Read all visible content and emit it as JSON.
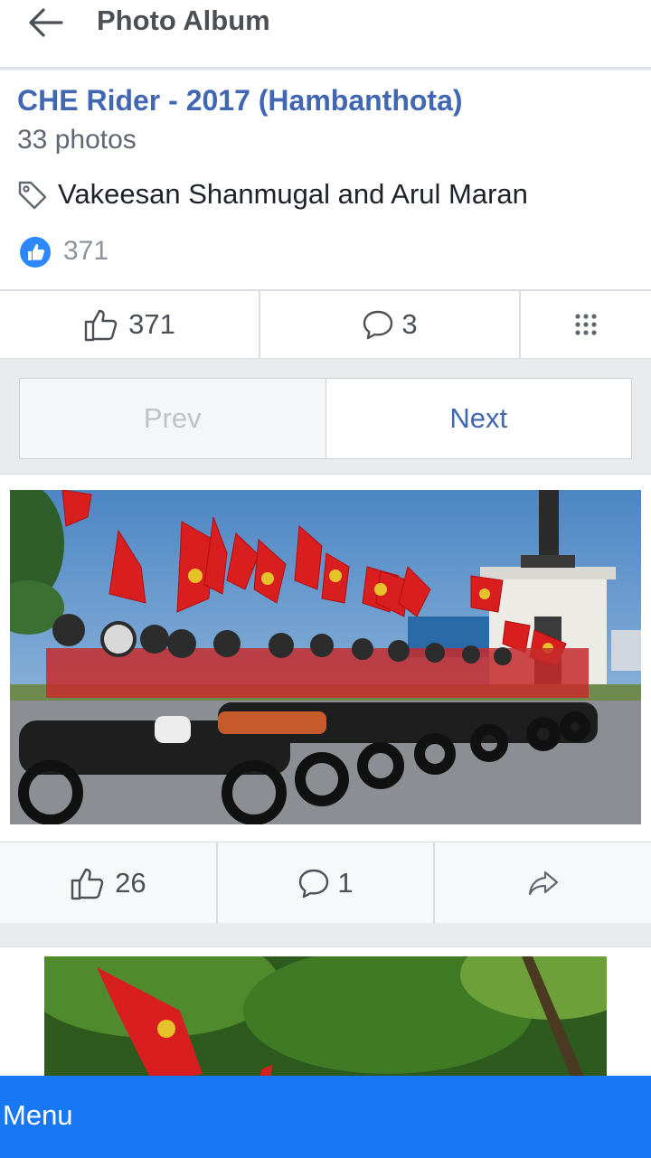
{
  "header": {
    "title": "Photo Album",
    "back_icon": "back-arrow-icon"
  },
  "album": {
    "title": "CHE Rider - 2017 (Hambanthota)",
    "photo_count": "33 photos",
    "tagged": "Vakeesan Shanmugal and Arul Maran",
    "reaction_count": "371"
  },
  "actions": {
    "like_count": "371",
    "comment_count": "3",
    "more_icon": "grid-dots-icon"
  },
  "pager": {
    "prev_label": "Prev",
    "next_label": "Next"
  },
  "post": {
    "like_count": "26",
    "comment_count": "1",
    "share_icon": "share-icon"
  },
  "menu": {
    "label": "Menu"
  },
  "colors": {
    "accent": "#4267b2",
    "menu_bar": "#1877f2",
    "like_badge": "#2d88ff",
    "flag_red": "#d81e1e"
  }
}
